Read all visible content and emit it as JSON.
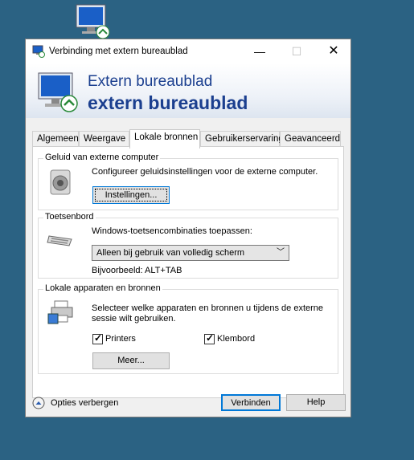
{
  "window": {
    "title": "Verbinding met extern bureaublad",
    "minimize": "—",
    "maximize": "☐",
    "close": "✕"
  },
  "banner": {
    "line1": "Extern bureaublad",
    "line2": "extern bureaublad"
  },
  "tabs": [
    {
      "label": "Algemeen"
    },
    {
      "label": "Weergave"
    },
    {
      "label": "Lokale bronnen",
      "active": true
    },
    {
      "label": "Gebruikerservaring"
    },
    {
      "label": "Geavanceerd"
    }
  ],
  "sound": {
    "title": "Geluid van externe computer",
    "description": "Configureer geluidsinstellingen voor de externe computer.",
    "button": "Instellingen..."
  },
  "keyboard": {
    "title": "Toetsenbord",
    "label": "Windows-toetsencombinaties toepassen:",
    "selected": "Alleen bij gebruik van volledig scherm",
    "example": "Bijvoorbeeld: ALT+TAB"
  },
  "devices": {
    "title": "Lokale apparaten en bronnen",
    "description_line1": "Selecteer welke apparaten en bronnen u tijdens de externe",
    "description_line2": "sessie wilt gebruiken.",
    "printers": "Printers",
    "printers_checked": true,
    "clipboard": "Klembord",
    "clipboard_checked": true,
    "more_button": "Meer..."
  },
  "footer": {
    "options_toggle": "Opties verbergen",
    "connect_button": "Verbinden",
    "help_button": "Help"
  },
  "colors": {
    "desktop": "#2b6283",
    "banner_text": "#1b3f8f",
    "focus_border": "#0078d7"
  }
}
